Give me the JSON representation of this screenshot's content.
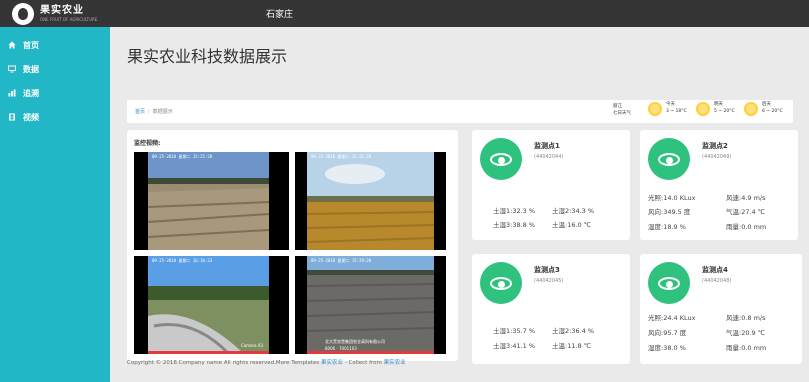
{
  "header": {
    "logo_title": "果实农业",
    "logo_subtitle": "ONE FRUIT OF AGRICULTURE",
    "city": "石家庄"
  },
  "sidebar": {
    "items": [
      {
        "label": "首页",
        "icon": "home-icon"
      },
      {
        "label": "数据",
        "icon": "monitor-icon"
      },
      {
        "label": "追溯",
        "icon": "chart-icon"
      },
      {
        "label": "视频",
        "icon": "film-icon"
      }
    ]
  },
  "page": {
    "title": "果实农业科技数据展示"
  },
  "breadcrumb": {
    "home": "首页",
    "current": "数据展示"
  },
  "weather": {
    "city": "丽江",
    "days_label": "七日天气",
    "days": [
      {
        "day": "今天",
        "range": "3 ~ 18°C"
      },
      {
        "day": "明天",
        "range": "5 ~ 20°C"
      },
      {
        "day": "后天",
        "range": "6 ~ 20°C"
      }
    ]
  },
  "video": {
    "label": "监控视频:",
    "feeds": [
      {
        "stamp": "09-25-2018 星期二 15:25:20",
        "footer": ""
      },
      {
        "stamp": "09-25-2018 星期二 15:25:20",
        "footer": ""
      },
      {
        "stamp": "09-25-2018 星期二 16:10:33",
        "footer": "Camera 03"
      },
      {
        "stamp": "09-25-2018 星期二 15:29:20",
        "footer": "北大荒农垦集团农业高科有限公司"
      }
    ],
    "feed4_id": "8006 · 7001103"
  },
  "sensors": [
    {
      "title": "监测点1",
      "id": "(44042044)",
      "readings": [
        "土湿1:32.3 %",
        "土湿2:34.3 %",
        "土湿3:38.8 %",
        "土温:16.0 ℃"
      ]
    },
    {
      "title": "监测点2",
      "id": "(44042049)",
      "readings": [
        "光照:14.0 KLux",
        "风速:4.9 m/s",
        "风向:349.5 度",
        "气温:27.4 ℃",
        "湿度:18.9 %",
        "雨量:0.0 mm"
      ]
    },
    {
      "title": "监测点3",
      "id": "(44042045)",
      "readings": [
        "土湿1:35.7 %",
        "土湿2:36.4 %",
        "土湿3:41.1 %",
        "土温:11.8 ℃"
      ]
    },
    {
      "title": "监测点4",
      "id": "(44042048)",
      "readings": [
        "光照:24.4 KLux",
        "风速:0.8 m/s",
        "风向:95.7 度",
        "气温:20.9 ℃",
        "湿度:38.0 %",
        "雨量:0.0 mm"
      ]
    }
  ],
  "footer": {
    "text": "Copyright © 2018.Company name All rights reserved.More Templates ",
    "link1": "果实农业",
    "middle": " - Collect from ",
    "link2": "果实农业"
  },
  "colors": {
    "topbar": "#353535",
    "sidebar": "#22b7c7",
    "sensor_icon": "#2ec27e",
    "link": "#3a87c8"
  }
}
